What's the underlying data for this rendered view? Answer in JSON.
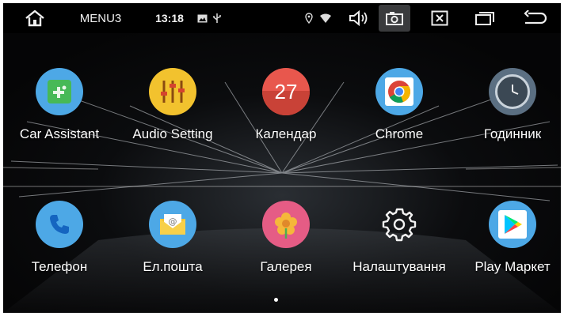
{
  "statusbar": {
    "title": "MENU3",
    "time": "13:18",
    "icons": [
      "home-icon",
      "image-icon",
      "usb-icon",
      "location-icon",
      "wifi-icon",
      "volume-icon",
      "screenshot-icon",
      "close-window-icon",
      "recent-apps-icon",
      "back-icon"
    ]
  },
  "apps": [
    {
      "label": "Car Assistant",
      "icon": "car-assistant-icon"
    },
    {
      "label": "Audio Setting",
      "icon": "equalizer-icon"
    },
    {
      "label": "Календар",
      "icon": "calendar-icon",
      "badge": "27"
    },
    {
      "label": "Chrome",
      "icon": "chrome-icon"
    },
    {
      "label": "Годинник",
      "icon": "clock-icon"
    },
    {
      "label": "Телефон",
      "icon": "phone-icon"
    },
    {
      "label": "Ел.пошта",
      "icon": "email-icon"
    },
    {
      "label": "Галерея",
      "icon": "gallery-icon"
    },
    {
      "label": "Налаштування",
      "icon": "settings-icon"
    },
    {
      "label": "Play Маркет",
      "icon": "play-store-icon"
    }
  ],
  "pager": {
    "current_page": 1
  }
}
